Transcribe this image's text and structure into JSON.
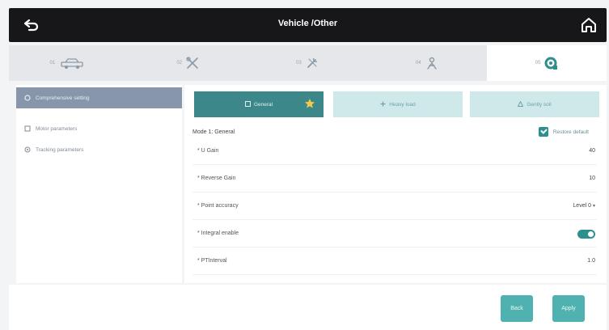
{
  "header": {
    "title": "Vehicle /Other"
  },
  "tabs": [
    {
      "num": "01",
      "icon": "vehicle-icon"
    },
    {
      "num": "02",
      "icon": "tools-icon"
    },
    {
      "num": "03",
      "icon": "wrench-icon"
    },
    {
      "num": "04",
      "icon": "person-icon"
    },
    {
      "num": "05",
      "icon": "settings-gear-icon",
      "active": true
    }
  ],
  "sidebar": {
    "items": [
      {
        "label": "Comprehensive setting",
        "icon": "gear-icon",
        "active": true
      },
      {
        "label": "Motor parameters",
        "icon": "motor-icon"
      },
      {
        "label": "Tracking parameters",
        "icon": "target-icon"
      }
    ]
  },
  "modes": [
    {
      "label": "General",
      "icon": "general-icon",
      "active": true
    },
    {
      "label": "Heavy load",
      "icon": "heavy-load-icon"
    },
    {
      "label": "Gently soil",
      "icon": "soil-icon"
    }
  ],
  "main": {
    "mode_title": "Mode 1: General",
    "restore_label": "Restore default",
    "rows": [
      {
        "label": "U Gain",
        "value": "40"
      },
      {
        "label": "Reverse Gain",
        "value": "10"
      },
      {
        "label": "Point accuracy",
        "value": "Level 0",
        "dropdown": true
      },
      {
        "label": "Integral enable",
        "toggle": true
      },
      {
        "label": "PTInterval",
        "value": "1.0"
      }
    ]
  },
  "footer": {
    "back_label": "Back",
    "apply_label": "Apply"
  },
  "colors": {
    "accent": "#2e8f8f",
    "button": "#4fb2b0",
    "sidebar_active": "#8796ab"
  }
}
